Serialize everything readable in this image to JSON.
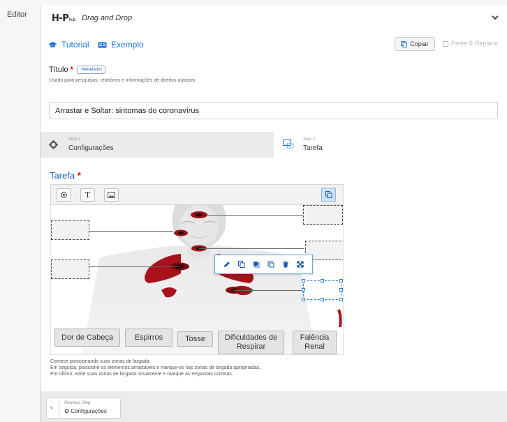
{
  "sidebar_label": "Editor",
  "header": {
    "logo_text": "H-P",
    "logo_sub": "hub",
    "library_name": "Drag and Drop",
    "chevron": "chevron-down-icon"
  },
  "toolbar": {
    "tutorial_label": "Tutorial",
    "example_label": "Exemplo",
    "copy_label": "Copiar",
    "paste_label": "Paste & Replace"
  },
  "title_field": {
    "label": "Título",
    "required_mark": "*",
    "metadata_label": "Metadados",
    "description": "Usado para pesquisas, relatórios e informações de direitos autorais",
    "value": "Arrastar e Soltar: sintomas do coronavírus"
  },
  "steps": [
    {
      "num": "Step 1",
      "title": "Configurações",
      "icon": "gear-icon"
    },
    {
      "num": "Step 2",
      "title": "Tarefa",
      "icon": "task-icon"
    }
  ],
  "task": {
    "heading": "Tarefa",
    "required_mark": "*",
    "tools": [
      "target-icon",
      "text-icon",
      "image-icon"
    ],
    "draggables": [
      {
        "label": "Dor de Cabeça"
      },
      {
        "label": "Espirros"
      },
      {
        "label": "Tosse"
      },
      {
        "label": "Dificuldades de Respirar"
      },
      {
        "label": "Falência Renal"
      }
    ],
    "context_icons": [
      "pencil-icon",
      "copy-icon",
      "bring-front-icon",
      "send-back-icon",
      "trash-icon",
      "expand-icon"
    ],
    "instructions": [
      "Comece posicionando suas zonas de largada.",
      "Em seguida, posicione os elementos arrastáveis e marque-os nas zonas de largada apropriadas.",
      "Por último, edite suas zonas de largada novamente e marque as respostas corretas."
    ]
  },
  "footer": {
    "previous_label": "Previous Step",
    "previous_title": "Configurações"
  },
  "colors": {
    "accent": "#1a73d9",
    "heading": "#1a5fb4",
    "required": "#dd0000",
    "organ": "#b0141a"
  }
}
